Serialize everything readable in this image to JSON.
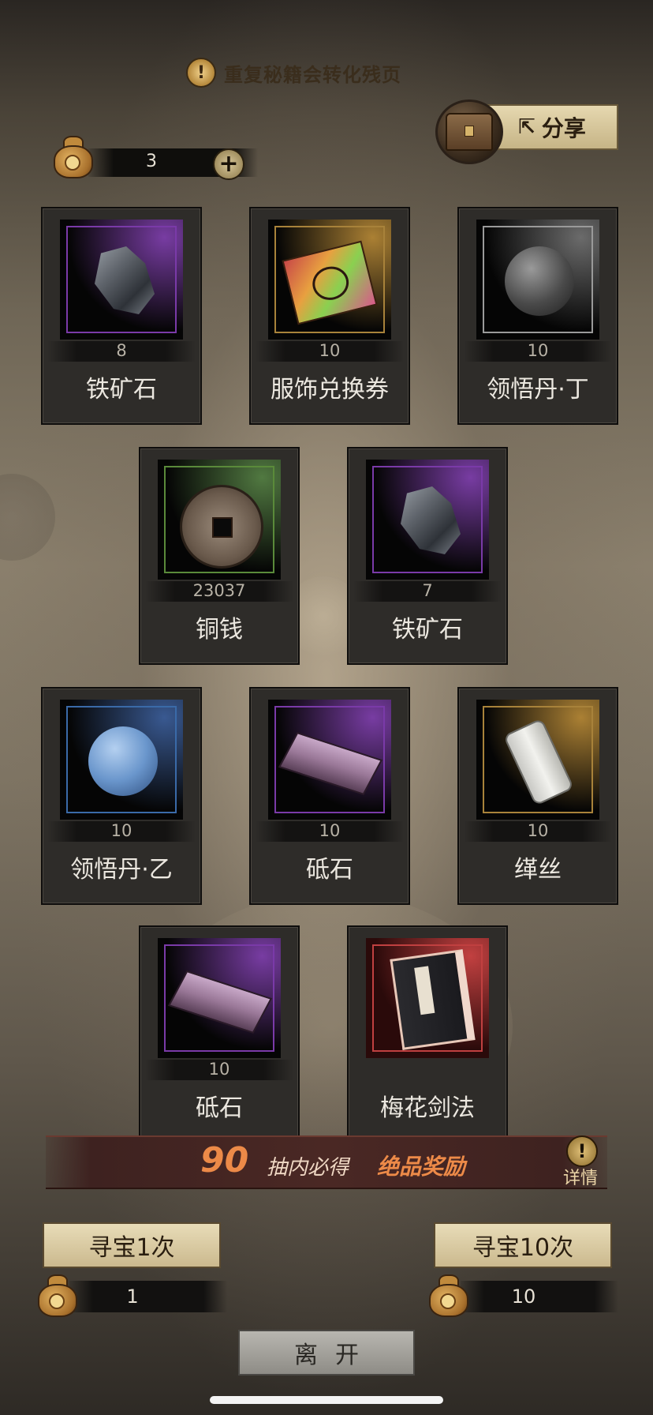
{
  "notice": "重复秘籍会转化残页",
  "share_label": "分享",
  "currency_amount": "3",
  "items": [
    {
      "name": "铁矿石",
      "qty": "8",
      "rarity_color": "#7a3aa8",
      "icon": "iron-ore-icon"
    },
    {
      "name": "服饰兑换券",
      "qty": "10",
      "rarity_color": "#a8823a",
      "icon": "outfit-coupon-icon"
    },
    {
      "name": "领悟丹·丁",
      "qty": "10",
      "rarity_color": "#9a9a9a",
      "icon": "grey-pill-icon"
    },
    {
      "name": "铜钱",
      "qty": "23037",
      "rarity_color": "#5a8a3a",
      "icon": "copper-coin-icon"
    },
    {
      "name": "铁矿石",
      "qty": "7",
      "rarity_color": "#7a3aa8",
      "icon": "iron-ore-icon"
    },
    {
      "name": "领悟丹·乙",
      "qty": "10",
      "rarity_color": "#3a6aa8",
      "icon": "blue-pill-icon"
    },
    {
      "name": "砥石",
      "qty": "10",
      "rarity_color": "#7a3aa8",
      "icon": "whetstone-icon"
    },
    {
      "name": "缂丝",
      "qty": "10",
      "rarity_color": "#a8823a",
      "icon": "silk-thread-icon"
    },
    {
      "name": "砥石",
      "qty": "10",
      "rarity_color": "#7a3aa8",
      "icon": "whetstone-icon"
    },
    {
      "name": "梅花剑法",
      "qty": "",
      "rarity_color": "#c04040",
      "icon": "manual-book-icon"
    }
  ],
  "guarantee": {
    "number": "90",
    "text1": "抽内必得",
    "text2": "绝品奖励",
    "detail": "详情"
  },
  "draw_once": {
    "label": "寻宝1次",
    "cost": "1"
  },
  "draw_ten": {
    "label": "寻宝10次",
    "cost": "10"
  },
  "leave_label": "离开"
}
